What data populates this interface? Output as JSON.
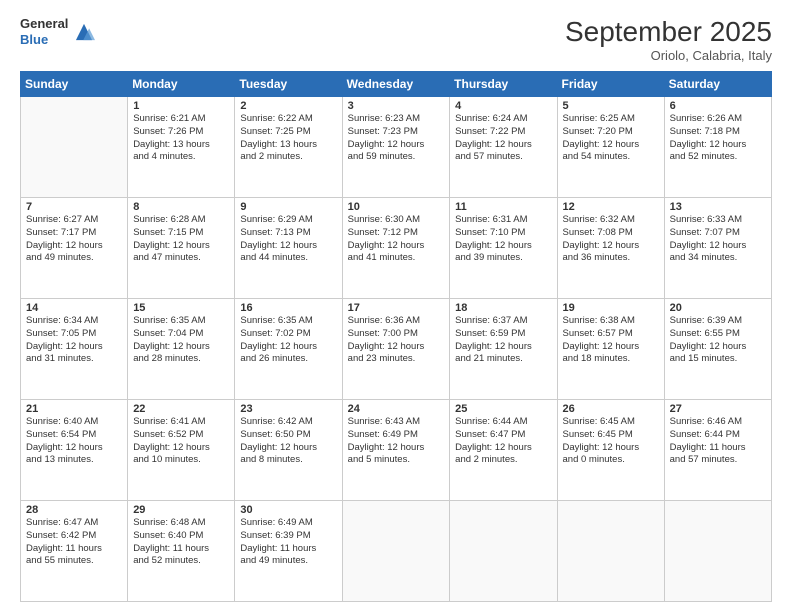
{
  "header": {
    "logo_general": "General",
    "logo_blue": "Blue",
    "month_title": "September 2025",
    "subtitle": "Oriolo, Calabria, Italy"
  },
  "days_of_week": [
    "Sunday",
    "Monday",
    "Tuesday",
    "Wednesday",
    "Thursday",
    "Friday",
    "Saturday"
  ],
  "weeks": [
    [
      {
        "day": "",
        "info": ""
      },
      {
        "day": "1",
        "info": "Sunrise: 6:21 AM\nSunset: 7:26 PM\nDaylight: 13 hours\nand 4 minutes."
      },
      {
        "day": "2",
        "info": "Sunrise: 6:22 AM\nSunset: 7:25 PM\nDaylight: 13 hours\nand 2 minutes."
      },
      {
        "day": "3",
        "info": "Sunrise: 6:23 AM\nSunset: 7:23 PM\nDaylight: 12 hours\nand 59 minutes."
      },
      {
        "day": "4",
        "info": "Sunrise: 6:24 AM\nSunset: 7:22 PM\nDaylight: 12 hours\nand 57 minutes."
      },
      {
        "day": "5",
        "info": "Sunrise: 6:25 AM\nSunset: 7:20 PM\nDaylight: 12 hours\nand 54 minutes."
      },
      {
        "day": "6",
        "info": "Sunrise: 6:26 AM\nSunset: 7:18 PM\nDaylight: 12 hours\nand 52 minutes."
      }
    ],
    [
      {
        "day": "7",
        "info": "Sunrise: 6:27 AM\nSunset: 7:17 PM\nDaylight: 12 hours\nand 49 minutes."
      },
      {
        "day": "8",
        "info": "Sunrise: 6:28 AM\nSunset: 7:15 PM\nDaylight: 12 hours\nand 47 minutes."
      },
      {
        "day": "9",
        "info": "Sunrise: 6:29 AM\nSunset: 7:13 PM\nDaylight: 12 hours\nand 44 minutes."
      },
      {
        "day": "10",
        "info": "Sunrise: 6:30 AM\nSunset: 7:12 PM\nDaylight: 12 hours\nand 41 minutes."
      },
      {
        "day": "11",
        "info": "Sunrise: 6:31 AM\nSunset: 7:10 PM\nDaylight: 12 hours\nand 39 minutes."
      },
      {
        "day": "12",
        "info": "Sunrise: 6:32 AM\nSunset: 7:08 PM\nDaylight: 12 hours\nand 36 minutes."
      },
      {
        "day": "13",
        "info": "Sunrise: 6:33 AM\nSunset: 7:07 PM\nDaylight: 12 hours\nand 34 minutes."
      }
    ],
    [
      {
        "day": "14",
        "info": "Sunrise: 6:34 AM\nSunset: 7:05 PM\nDaylight: 12 hours\nand 31 minutes."
      },
      {
        "day": "15",
        "info": "Sunrise: 6:35 AM\nSunset: 7:04 PM\nDaylight: 12 hours\nand 28 minutes."
      },
      {
        "day": "16",
        "info": "Sunrise: 6:35 AM\nSunset: 7:02 PM\nDaylight: 12 hours\nand 26 minutes."
      },
      {
        "day": "17",
        "info": "Sunrise: 6:36 AM\nSunset: 7:00 PM\nDaylight: 12 hours\nand 23 minutes."
      },
      {
        "day": "18",
        "info": "Sunrise: 6:37 AM\nSunset: 6:59 PM\nDaylight: 12 hours\nand 21 minutes."
      },
      {
        "day": "19",
        "info": "Sunrise: 6:38 AM\nSunset: 6:57 PM\nDaylight: 12 hours\nand 18 minutes."
      },
      {
        "day": "20",
        "info": "Sunrise: 6:39 AM\nSunset: 6:55 PM\nDaylight: 12 hours\nand 15 minutes."
      }
    ],
    [
      {
        "day": "21",
        "info": "Sunrise: 6:40 AM\nSunset: 6:54 PM\nDaylight: 12 hours\nand 13 minutes."
      },
      {
        "day": "22",
        "info": "Sunrise: 6:41 AM\nSunset: 6:52 PM\nDaylight: 12 hours\nand 10 minutes."
      },
      {
        "day": "23",
        "info": "Sunrise: 6:42 AM\nSunset: 6:50 PM\nDaylight: 12 hours\nand 8 minutes."
      },
      {
        "day": "24",
        "info": "Sunrise: 6:43 AM\nSunset: 6:49 PM\nDaylight: 12 hours\nand 5 minutes."
      },
      {
        "day": "25",
        "info": "Sunrise: 6:44 AM\nSunset: 6:47 PM\nDaylight: 12 hours\nand 2 minutes."
      },
      {
        "day": "26",
        "info": "Sunrise: 6:45 AM\nSunset: 6:45 PM\nDaylight: 12 hours\nand 0 minutes."
      },
      {
        "day": "27",
        "info": "Sunrise: 6:46 AM\nSunset: 6:44 PM\nDaylight: 11 hours\nand 57 minutes."
      }
    ],
    [
      {
        "day": "28",
        "info": "Sunrise: 6:47 AM\nSunset: 6:42 PM\nDaylight: 11 hours\nand 55 minutes."
      },
      {
        "day": "29",
        "info": "Sunrise: 6:48 AM\nSunset: 6:40 PM\nDaylight: 11 hours\nand 52 minutes."
      },
      {
        "day": "30",
        "info": "Sunrise: 6:49 AM\nSunset: 6:39 PM\nDaylight: 11 hours\nand 49 minutes."
      },
      {
        "day": "",
        "info": ""
      },
      {
        "day": "",
        "info": ""
      },
      {
        "day": "",
        "info": ""
      },
      {
        "day": "",
        "info": ""
      }
    ]
  ]
}
